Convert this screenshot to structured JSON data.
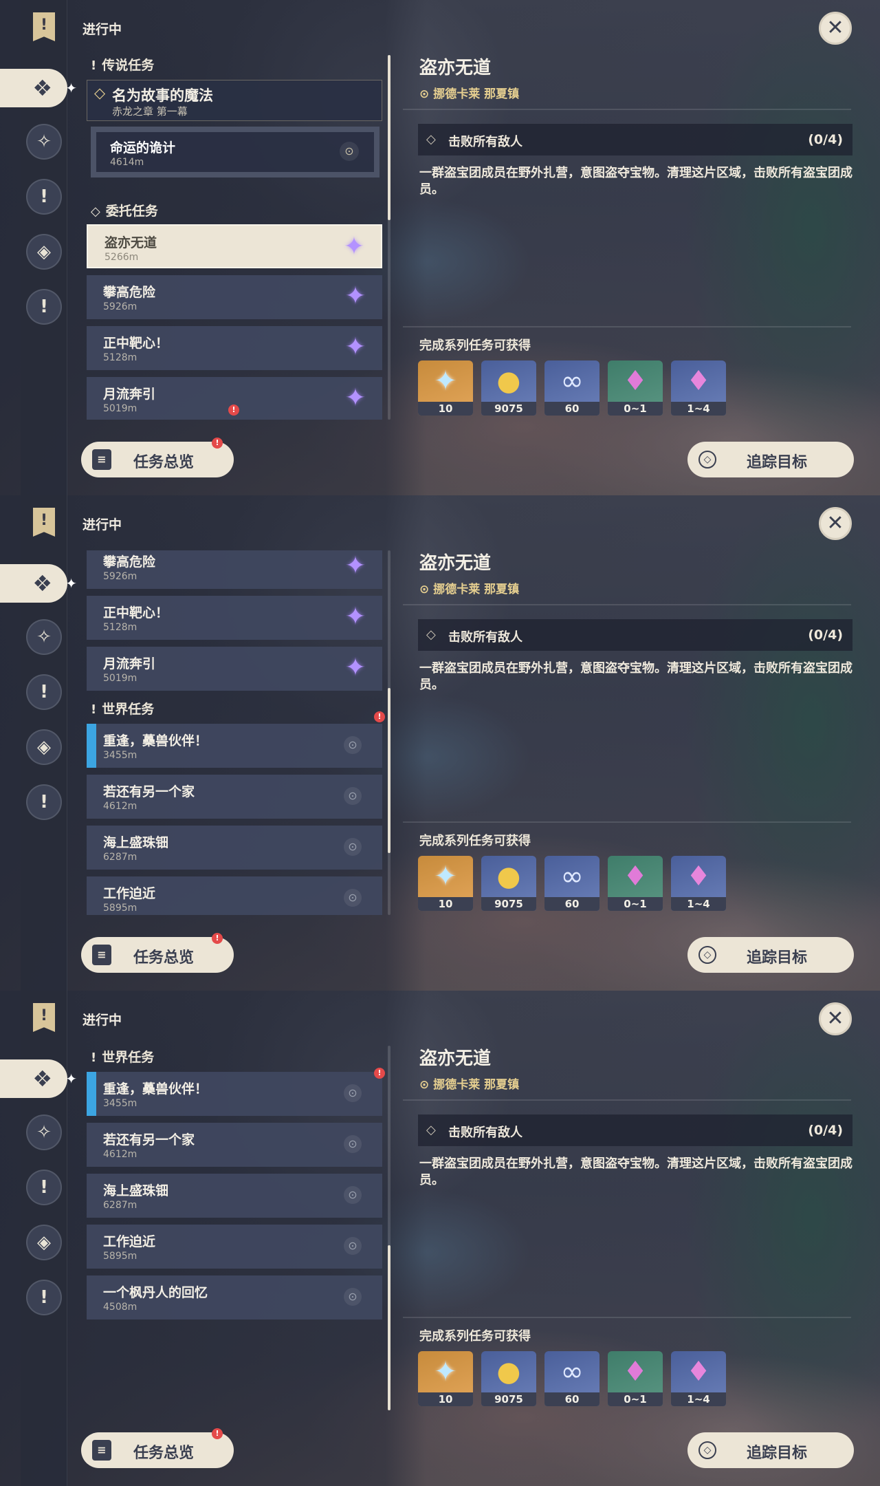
{
  "header": {
    "status": "进行中",
    "close_glyph": "✕"
  },
  "rail": {
    "top_glyph": "!",
    "icons": [
      "quest-all-icon",
      "archon-quest-icon",
      "legend-quest-icon",
      "commission-quest-icon",
      "world-quest-icon"
    ],
    "glyphs": [
      "❖",
      "✧",
      "!",
      "◈",
      "!"
    ]
  },
  "sections": {
    "legend": "传说任务",
    "commission": "委托任务",
    "world": "世界任务"
  },
  "legend_quest": {
    "title": "名为故事的魔法",
    "chapter": "赤龙之章 第一幕",
    "sub_title": "命运的诡计",
    "sub_distance": "4614m"
  },
  "commissions": [
    {
      "title": "盗亦无道",
      "distance": "5266m"
    },
    {
      "title": "攀高危险",
      "distance": "5926m"
    },
    {
      "title": "正中靶心！",
      "distance": "5128m"
    },
    {
      "title": "月流奔引",
      "distance": "5019m"
    }
  ],
  "world_quests": [
    {
      "title": "重逢，蘽兽伙伴！",
      "distance": "3455m"
    },
    {
      "title": "若还有另一个家",
      "distance": "4612m"
    },
    {
      "title": "海上盛珠钿",
      "distance": "6287m"
    },
    {
      "title": "工作迫近",
      "distance": "5895m"
    },
    {
      "title": "一个枫丹人的回忆",
      "distance": "4508m"
    }
  ],
  "detail": {
    "title": "盗亦无道",
    "location": "挪德卡莱 那夏镇",
    "objective": "击败所有敌人",
    "progress": "(0/4)",
    "description": "一群盗宝团成员在野外扎营，意图盗夺宝物。清理这片区域，击败所有盗宝团成员。",
    "rewards_label": "完成系列任务可获得",
    "rewards": [
      {
        "icon": "primogem-icon",
        "glyph": "✦",
        "count": "10"
      },
      {
        "icon": "mora-icon",
        "glyph": "●",
        "count": "9075"
      },
      {
        "icon": "companionship-exp-icon",
        "glyph": "∞",
        "count": "60"
      },
      {
        "icon": "crystal-chunk-icon",
        "glyph": "♦",
        "count": "0~1"
      },
      {
        "icon": "crystal-cluster-icon",
        "glyph": "♦",
        "count": "1~4"
      }
    ]
  },
  "buttons": {
    "overview": "任务总览",
    "overview_badge": "!",
    "track": "追踪目标",
    "track_glyph": "◇"
  },
  "misc": {
    "alert": "!",
    "pin": "⊙",
    "star": "✦",
    "loc_glyph": "⊙",
    "obj_glyph": "◇",
    "book_glyph": "≡"
  },
  "colors": {
    "accent_gold": "#e6cf90",
    "cream": "#ece5d6",
    "commission_star": "#b392ff",
    "track_marker": "#3ca5e2",
    "badge_red": "#e44a4a"
  }
}
